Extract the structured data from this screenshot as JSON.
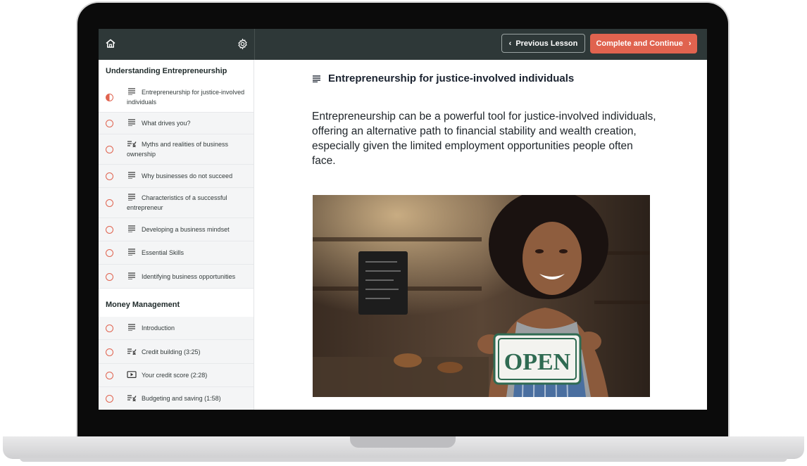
{
  "topbar": {
    "prev_label": "Previous Lesson",
    "next_label": "Complete and Continue",
    "accent_color": "#e0634f",
    "bar_color": "#2e3838"
  },
  "sidebar": {
    "sections": [
      {
        "title": "Understanding Entrepreneurship",
        "lessons": [
          {
            "label": "Entrepreneurship for justice-involved individuals",
            "icon": "text-lines-icon",
            "status": "in-progress"
          },
          {
            "label": "What drives you?",
            "icon": "text-lines-icon",
            "status": "incomplete"
          },
          {
            "label": "Myths and realities of business ownership",
            "icon": "quiz-icon",
            "status": "incomplete"
          },
          {
            "label": "Why businesses do not succeed",
            "icon": "text-lines-icon",
            "status": "incomplete"
          },
          {
            "label": "Characteristics of a successful entrepreneur",
            "icon": "text-lines-icon",
            "status": "incomplete"
          },
          {
            "label": "Developing a business mindset",
            "icon": "text-lines-icon",
            "status": "incomplete"
          },
          {
            "label": "Essential Skills",
            "icon": "text-lines-icon",
            "status": "incomplete"
          },
          {
            "label": "Identifying business opportunities",
            "icon": "text-lines-icon",
            "status": "incomplete"
          }
        ]
      },
      {
        "title": "Money Management",
        "lessons": [
          {
            "label": "Introduction",
            "icon": "text-lines-icon",
            "status": "incomplete"
          },
          {
            "label": "Credit building (3:25)",
            "icon": "quiz-icon",
            "status": "incomplete"
          },
          {
            "label": "Your credit score (2:28)",
            "icon": "video-icon",
            "status": "incomplete"
          },
          {
            "label": "Budgeting and saving (1:58)",
            "icon": "quiz-icon",
            "status": "incomplete"
          }
        ]
      }
    ]
  },
  "content": {
    "title": "Entrepreneurship for justice-involved individuals",
    "body": "Entrepreneurship can be a powerful tool for justice-involved individuals, offering an alternative path to financial stability and wealth creation, especially given the limited employment opportunities people often face.",
    "image_sign_text": "OPEN"
  }
}
